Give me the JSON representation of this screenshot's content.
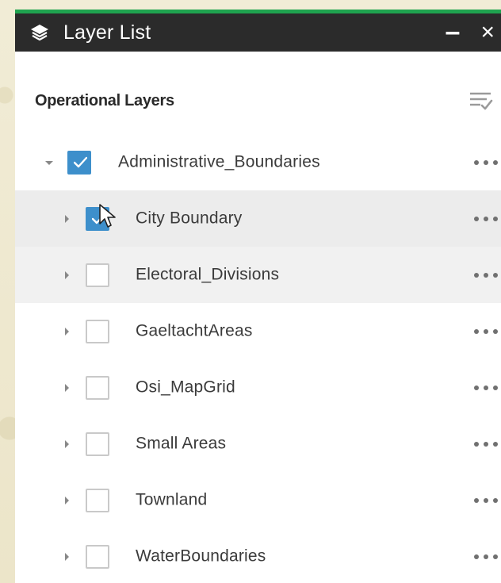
{
  "panel": {
    "title": "Layer List",
    "title_icon": "layers-icon",
    "minimize_label": "–",
    "close_label": "×",
    "colors": {
      "titlebar": "#2b2b2b",
      "accent_strip": "#1fa34f",
      "checkbox_checked": "#3d8fcb"
    }
  },
  "section": {
    "title": "Operational Layers",
    "filter_icon": "filter-check-icon"
  },
  "layers": [
    {
      "label": "Administrative_Boundaries",
      "checked": true,
      "expanded": true,
      "level": 0
    },
    {
      "label": "City Boundary",
      "checked": true,
      "expanded": false,
      "level": 1,
      "highlight": true
    },
    {
      "label": "Electoral_Divisions",
      "checked": false,
      "expanded": false,
      "level": 1,
      "highlight": true
    },
    {
      "label": "GaeltachtAreas",
      "checked": false,
      "expanded": false,
      "level": 1
    },
    {
      "label": "Osi_MapGrid",
      "checked": false,
      "expanded": false,
      "level": 1
    },
    {
      "label": "Small Areas",
      "checked": false,
      "expanded": false,
      "level": 1
    },
    {
      "label": "Townland",
      "checked": false,
      "expanded": false,
      "level": 1
    },
    {
      "label": "WaterBoundaries",
      "checked": false,
      "expanded": false,
      "level": 1
    }
  ]
}
